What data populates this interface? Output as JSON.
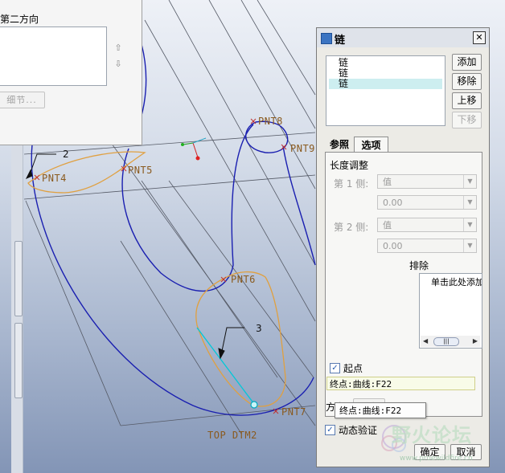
{
  "viewport": {
    "points": [
      {
        "id": "pnt8",
        "label": "PNT8"
      },
      {
        "id": "pnt9",
        "label": "PNT9"
      },
      {
        "id": "pnt4",
        "label": "PNT4"
      },
      {
        "id": "pnt5",
        "label": "PNT5"
      },
      {
        "id": "pnt6",
        "label": "PNT6"
      },
      {
        "id": "pnt7",
        "label": "PNT7"
      }
    ],
    "markers": [
      {
        "id": "marker-2",
        "label": "2"
      },
      {
        "id": "marker-3",
        "label": "3"
      }
    ],
    "plane_label": "TOP DTM2",
    "colors": {
      "curve": "#1a1fb0",
      "sketch": "#e0a040",
      "selection": "#00c8d8",
      "plane": "#555a66"
    }
  },
  "direction_panel": {
    "title": "第二方向",
    "detail_button": "细节...",
    "up_icon": "up-arrow-icon",
    "down_icon": "down-arrow-icon"
  },
  "chain_dialog": {
    "title": "链",
    "close_icon": "close-icon",
    "items": [
      "链",
      "链",
      "链"
    ],
    "selected_index": 2,
    "buttons": {
      "add": "添加",
      "remove": "移除",
      "move_up": "上移",
      "move_down": "下移"
    },
    "tabs": {
      "references": "参照",
      "options": "选项"
    },
    "active_tab": "选项",
    "length_adjust": "长度调整",
    "side1_label": "第 1 侧:",
    "side1_type": "值",
    "side1_value": "0.00",
    "side2_label": "第 2 侧:",
    "side2_type": "值",
    "side2_value": "0.00",
    "exclude_label": "排除",
    "exclude_placeholder": "单击此处添加",
    "start_point_label": "起点",
    "start_point_checked": true,
    "start_point_value": "终点:曲线:F22",
    "direction_label": "方向:",
    "direction_button": "反向",
    "tooltip": "终点:曲线:F22",
    "dynamic_preview_label": "动态验证",
    "dynamic_preview_checked": true,
    "ok": "确定",
    "cancel": "取消"
  },
  "watermark": {
    "text": "野火论坛",
    "url": "www.proewildfire.cn"
  }
}
